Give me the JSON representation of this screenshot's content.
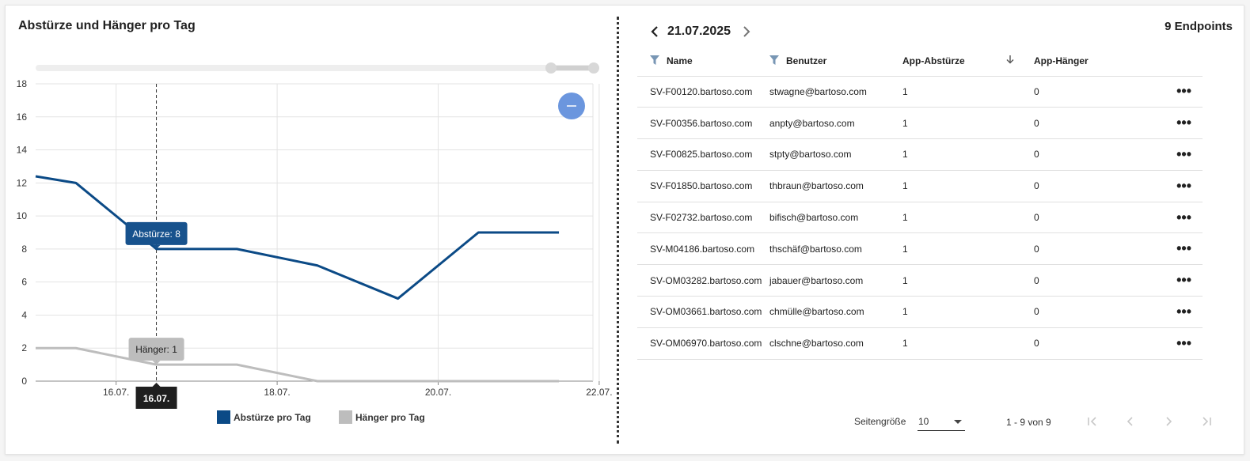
{
  "chart": {
    "title": "Abstürze und Hänger pro Tag",
    "legend": [
      {
        "label": "Abstürze pro Tag",
        "color": "#0b4a86"
      },
      {
        "label": "Hänger pro Tag",
        "color": "#bdbdbd"
      }
    ],
    "tooltip_crash": "Abstürze: 8",
    "tooltip_hang": "Hänger: 1",
    "cursor_label": "16.07.",
    "reset_zoom_icon": "minus-icon"
  },
  "chart_data": {
    "type": "line",
    "x": [
      "15.07. 00:00",
      "15.07. 12:00",
      "16.07. 12:00",
      "17.07. 12:00",
      "18.07. 12:00",
      "19.07. 12:00",
      "20.07. 12:00",
      "21.07. 12:00"
    ],
    "x_tick_labels": [
      "16.07.",
      "18.07.",
      "20.07.",
      "22.07."
    ],
    "series": [
      {
        "name": "Abstürze pro Tag",
        "color": "#0b4a86",
        "values": [
          12.4,
          12,
          8,
          8,
          7,
          5,
          9,
          9
        ]
      },
      {
        "name": "Hänger pro Tag",
        "color": "#bdbdbd",
        "values": [
          2,
          2,
          1,
          1,
          0,
          0,
          0,
          0
        ]
      }
    ],
    "ylim": [
      0,
      18
    ],
    "y_ticks": [
      0,
      2,
      4,
      6,
      8,
      10,
      12,
      14,
      16,
      18
    ],
    "grid": true,
    "legend": "bottom"
  },
  "date_nav": {
    "date": "21.07.2025",
    "prev_icon": "chevron-left-icon",
    "next_icon": "chevron-right-icon"
  },
  "endpoints_count": "9 Endpoints",
  "table": {
    "columns": [
      "Name",
      "Benutzer",
      "App-Abstürze",
      "App-Hänger"
    ],
    "sort_icon": "arrow-down-icon",
    "more_label": "•••",
    "rows": [
      {
        "name": "SV-F00120.bartoso.com",
        "user": "stwagne@bartoso.com",
        "crashes": "1",
        "hangs": "0"
      },
      {
        "name": "SV-F00356.bartoso.com",
        "user": "anpty@bartoso.com",
        "crashes": "1",
        "hangs": "0"
      },
      {
        "name": "SV-F00825.bartoso.com",
        "user": "stpty@bartoso.com",
        "crashes": "1",
        "hangs": "0"
      },
      {
        "name": "SV-F01850.bartoso.com",
        "user": "thbraun@bartoso.com",
        "crashes": "1",
        "hangs": "0"
      },
      {
        "name": "SV-F02732.bartoso.com",
        "user": "bifisch@bartoso.com",
        "crashes": "1",
        "hangs": "0"
      },
      {
        "name": "SV-M04186.bartoso.com",
        "user": "thschäf@bartoso.com",
        "crashes": "1",
        "hangs": "0"
      },
      {
        "name": "SV-OM03282.bartoso.com",
        "user": "jabauer@bartoso.com",
        "crashes": "1",
        "hangs": "0"
      },
      {
        "name": "SV-OM03661.bartoso.com",
        "user": "chmülle@bartoso.com",
        "crashes": "1",
        "hangs": "0"
      },
      {
        "name": "SV-OM06970.bartoso.com",
        "user": "clschne@bartoso.com",
        "crashes": "1",
        "hangs": "0"
      }
    ]
  },
  "pager": {
    "page_size_label": "Seitengröße",
    "page_size": "10",
    "range": "1 - 9 von 9"
  }
}
